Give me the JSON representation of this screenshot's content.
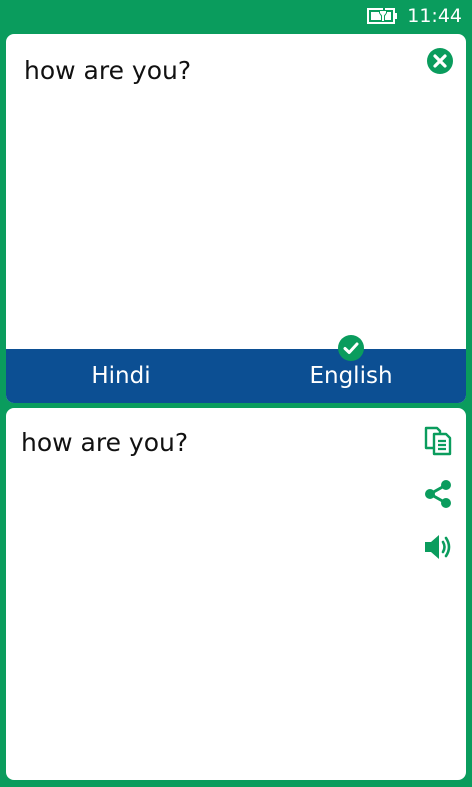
{
  "status_bar": {
    "time": "11:44",
    "battery_icon": "battery-charging-icon"
  },
  "input": {
    "text": "how are you?",
    "clear_icon": "close-circle-icon"
  },
  "languages": {
    "source": "Hindi",
    "target": "English",
    "selected": "English",
    "selected_icon": "checkmark-circle-icon"
  },
  "output": {
    "text": "how are you?",
    "actions": [
      {
        "name": "copy",
        "icon": "copy-icon"
      },
      {
        "name": "share",
        "icon": "share-icon"
      },
      {
        "name": "speak",
        "icon": "speaker-icon"
      }
    ]
  },
  "colors": {
    "accent_green": "#0a9c5d",
    "language_bar_blue": "#0c4f93",
    "card_background": "#ffffff",
    "text": "#111111"
  }
}
